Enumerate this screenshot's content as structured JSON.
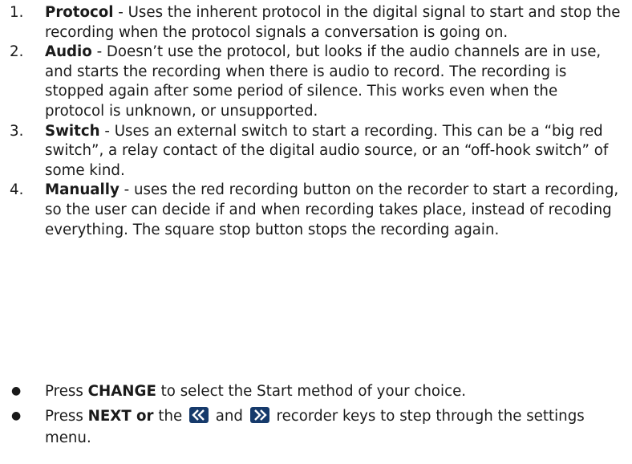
{
  "methods": [
    {
      "number": "1.",
      "term": "Protocol",
      "text": " - Uses the inherent protocol in the digital signal to start and stop the recording when the protocol signals a conversation is going on."
    },
    {
      "number": "2.",
      "term": "Audio",
      "text": " - Doesn’t use the protocol, but looks if the audio channels are in use, and starts the recording when there is audio to record. The recording is stopped again after some period of silence. This works even when the protocol is unknown, or unsupported."
    },
    {
      "number": "3.",
      "term": "Switch",
      "text": " - Uses an external switch to start a recording. This can be a “big red switch”, a relay contact of the digital audio source, or an “off-hook switch” of some kind."
    },
    {
      "number": "4.",
      "term": "Manually",
      "text": " - uses the red recording button on the recorder to start a recording,  so the user can decide if and when recording takes place, instead of recoding everything. The square stop button stops the recording again."
    }
  ],
  "bullets": {
    "change": {
      "pre": "Press ",
      "key": "CHANGE",
      "post": " to select the Start method of your choice."
    },
    "next": {
      "pre": "Press ",
      "key": "NEXT or",
      "mid1": " the ",
      "mid2": " and ",
      "post": " recorder keys to step through the settings menu."
    }
  },
  "icons": {
    "prev_key": "rewind-key-icon",
    "next_key": "fast-forward-key-icon",
    "key_color": "#163a6b"
  }
}
